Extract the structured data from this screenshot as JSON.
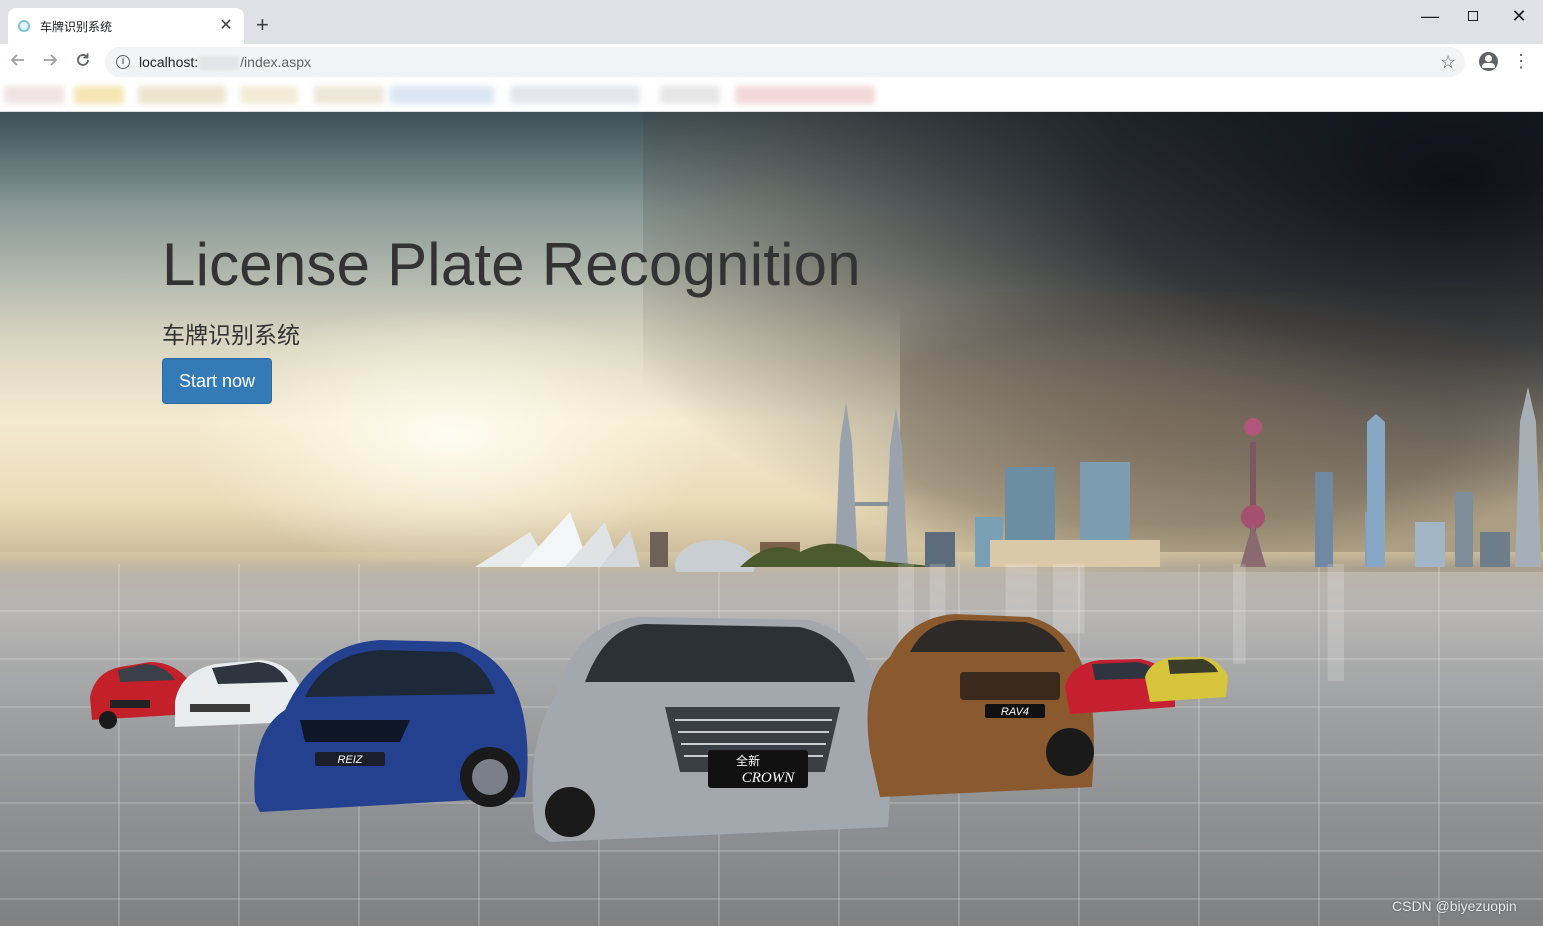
{
  "browser": {
    "tab_title": "车牌识别系统",
    "tab_close": "✕",
    "new_tab": "+",
    "url_host": "localhost:",
    "url_path": "/index.aspx",
    "window_min": "—",
    "window_close": "✕",
    "star": "☆",
    "menu": "⋮"
  },
  "hero": {
    "title": "License Plate Recognition",
    "subtitle": "车牌识别系统",
    "button_label": "Start now",
    "button_color": "#337ab7",
    "plate_reiz": "REIZ",
    "plate_crown_cn": "全新",
    "plate_crown": "CROWN",
    "plate_rav4": "RAV4"
  },
  "watermark": "CSDN @biyezuopin"
}
